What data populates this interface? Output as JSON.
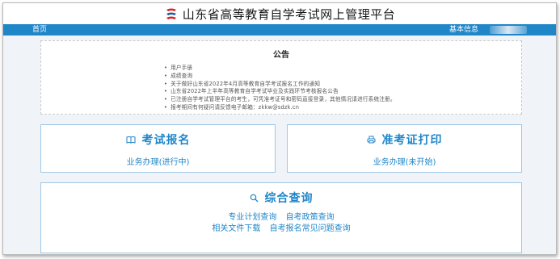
{
  "header": {
    "logo_icon": "provincial-exam-logo",
    "title": "山东省高等教育自学考试网上管理平台"
  },
  "nav": {
    "home": "首页",
    "basic_info": "基本信息"
  },
  "notice": {
    "title": "公告",
    "items": [
      "用户手册",
      "成绩查询",
      "关于做好山东省2022年4月高等教育自学考试报名工作的通知",
      "山东省2022年上半年高等教育自学考试毕业及实践环节考核报名公告",
      "已注册自学考试管理平台的考生，可凭准考证号和密码直接登录，其他情况请进行系统注册。",
      "报考期间有何疑问请反馈电子邮箱：zkkw@sdzk.cn"
    ]
  },
  "cards": {
    "exam": {
      "icon": "book-icon",
      "title": "考试报名",
      "subtitle": "业务办理(进行中)"
    },
    "print": {
      "icon": "printer-icon",
      "title": "准考证打印",
      "subtitle": "业务办理(未开始)"
    },
    "query": {
      "icon": "search-icon",
      "title": "综合查询",
      "links_row1": [
        "专业计划查询",
        "自考政策查询"
      ],
      "links_row2": [
        "相关文件下载",
        "自考报名常见问题查询"
      ]
    }
  },
  "colors": {
    "accent": "#1f86c8",
    "card_border": "#9fc7e6",
    "page_bg": "#f0f4f8",
    "logo_red": "#e02020",
    "logo_blue": "#1c5aa8"
  }
}
